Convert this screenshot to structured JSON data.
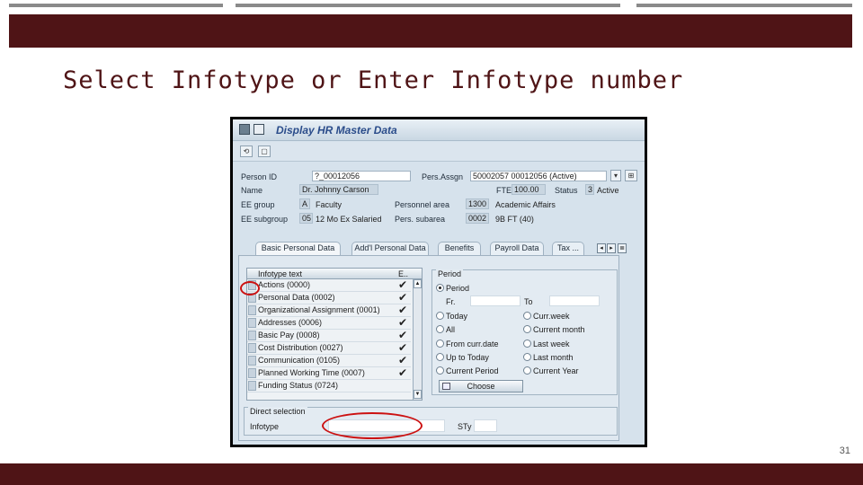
{
  "slide": {
    "title": "Select Infotype or Enter Infotype number",
    "page_number": "31",
    "colors": {
      "band": "#4f1416",
      "annotation": "#cc1111"
    }
  },
  "sap": {
    "window_title": "Display HR Master Data",
    "header": {
      "person_id_label": "Person ID",
      "person_id_value": "?_00012056",
      "pers_assgn_label": "Pers.Assgn",
      "pers_assgn_value": "50002057 00012056 (Active)",
      "name_label": "Name",
      "name_value": "Dr. Johnny Carson",
      "fte_label": "FTE",
      "fte_value": "100.00",
      "status_label": "Status",
      "status_code": "3",
      "status_text": "Active",
      "ee_group_label": "EE group",
      "ee_group_code": "A",
      "ee_group_text": "Faculty",
      "personnel_area_label": "Personnel area",
      "personnel_area_code": "1300",
      "personnel_area_text": "Academic Affairs",
      "ee_subgroup_label": "EE subgroup",
      "ee_subgroup_code": "05",
      "ee_subgroup_text": "12 Mo Ex Salaried",
      "pers_subarea_label": "Pers. subarea",
      "pers_subarea_code": "0002",
      "pers_subarea_text": "9B FT (40)"
    },
    "tabs": [
      {
        "label": "Basic Personal Data"
      },
      {
        "label": "Add'l Personal Data"
      },
      {
        "label": "Benefits"
      },
      {
        "label": "Payroll Data"
      },
      {
        "label": "Tax ..."
      }
    ],
    "infotype_list": {
      "col_text": "Infotype text",
      "col_e": "E..",
      "rows": [
        {
          "name": "Actions (0000)",
          "check": "✔"
        },
        {
          "name": "Personal Data (0002)",
          "check": "✔"
        },
        {
          "name": "Organizational Assignment (0001)",
          "check": "✔"
        },
        {
          "name": "Addresses (0006)",
          "check": "✔"
        },
        {
          "name": "Basic Pay (0008)",
          "check": "✔"
        },
        {
          "name": "Cost Distribution (0027)",
          "check": "✔"
        },
        {
          "name": "Communication (0105)",
          "check": "✔"
        },
        {
          "name": "Planned Working Time (0007)",
          "check": "✔"
        },
        {
          "name": "Funding Status (0724)",
          "check": ""
        }
      ]
    },
    "period": {
      "title": "Period",
      "period_option": "Period",
      "from_label": "Fr.",
      "to_label": "To",
      "options_left": [
        "Today",
        "All",
        "From curr.date",
        "Up to Today",
        "Current Period"
      ],
      "options_right": [
        "Curr.week",
        "Current month",
        "Last week",
        "Last month",
        "Current Year"
      ],
      "choose_label": "Choose"
    },
    "direct_selection": {
      "title": "Direct selection",
      "infotype_label": "Infotype",
      "infotype_value": "",
      "sty_label": "STy",
      "sty_value": ""
    }
  }
}
